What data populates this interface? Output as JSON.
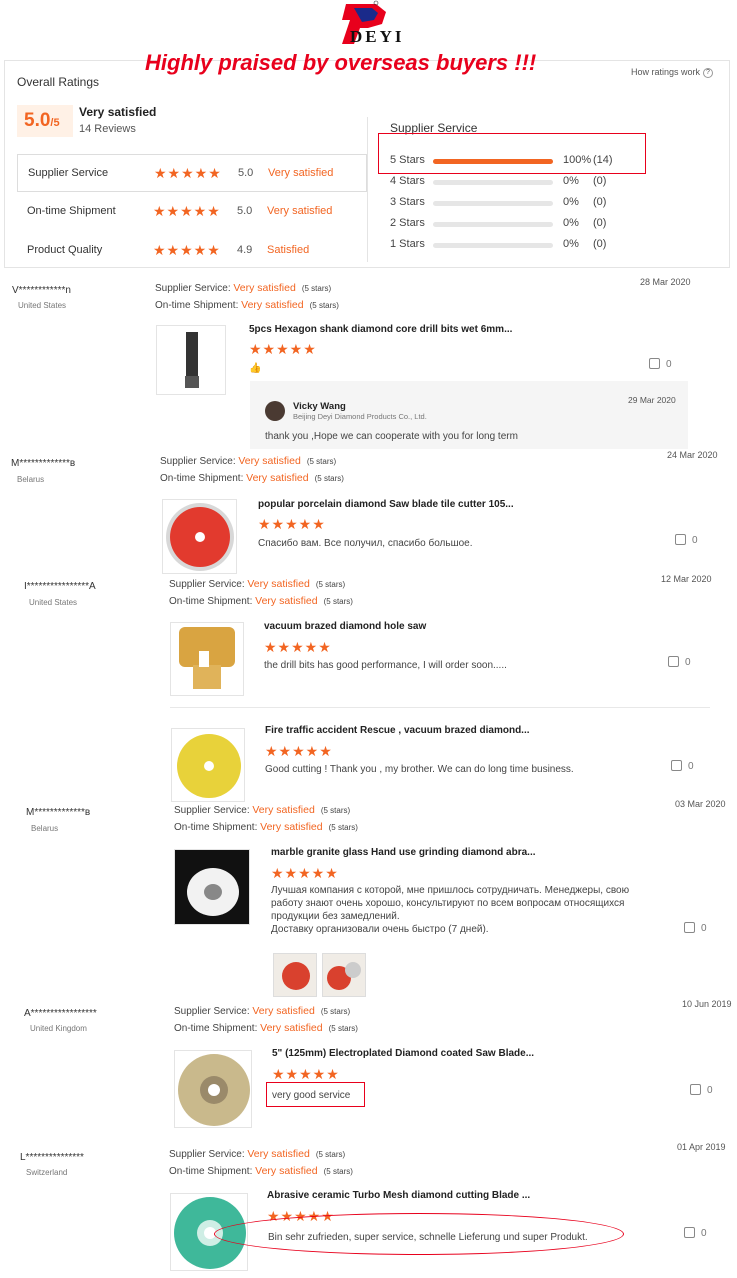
{
  "brand": {
    "logo_text": "DEYI",
    "headline": "Highly praised by overseas buyers !!!"
  },
  "overall": {
    "title": "Overall Ratings",
    "how_link": "How ratings work",
    "score": "5.0",
    "score_suffix": "/5",
    "label": "Very satisfied",
    "count": "14 Reviews",
    "categories": [
      {
        "label": "Supplier Service",
        "stars": "★★★★★",
        "score": "5.0",
        "word": "Very satisfied"
      },
      {
        "label": "On-time Shipment",
        "stars": "★★★★★",
        "score": "5.0",
        "word": "Very satisfied"
      },
      {
        "label": "Product Quality",
        "stars": "★★★★★",
        "score": "4.9",
        "word": "Satisfied"
      }
    ]
  },
  "supplier_service": {
    "title": "Supplier Service",
    "rows": [
      {
        "label": "5 Stars",
        "pct": "100%",
        "count": "(14)",
        "fraction": 1.0
      },
      {
        "label": "4 Stars",
        "pct": "0%",
        "count": "(0)",
        "fraction": 0
      },
      {
        "label": "3 Stars",
        "pct": "0%",
        "count": "(0)",
        "fraction": 0
      },
      {
        "label": "2 Stars",
        "pct": "0%",
        "count": "(0)",
        "fraction": 0
      },
      {
        "label": "1 Stars",
        "pct": "0%",
        "count": "(0)",
        "fraction": 0
      }
    ]
  },
  "labels": {
    "supplier_service": "Supplier Service:",
    "ontime_shipment": "On-time Shipment:",
    "very_satisfied": "Very satisfied",
    "five_stars": "(5 stars)",
    "stars": "★★★★★"
  },
  "reviews": [
    {
      "user": "V************n",
      "country": "United States",
      "date": "28 Mar 2020",
      "title": "5pcs Hexagon shank diamond core drill bits wet 6mm...",
      "text": "👍",
      "likes": "0"
    },
    {
      "user": "M*************в",
      "country": "Belarus",
      "date": "24 Mar 2020",
      "title": "popular porcelain diamond Saw blade tile cutter 105...",
      "text": "Спасибо вам. Все получил, спасибо большое.",
      "likes": "0"
    },
    {
      "user": "I****************A",
      "country": "United States",
      "date": "12 Mar 2020",
      "title": "vacuum brazed diamond hole saw",
      "text": "the drill bits has good performance, I will order soon.....",
      "likes": "0"
    },
    {
      "user": "",
      "country": "",
      "date": "",
      "title": "Fire traffic accident Rescue , vacuum brazed diamond...",
      "text": "Good cutting ! Thank you , my brother. We can do long time business.",
      "likes": "0"
    },
    {
      "user": "M*************в",
      "country": "Belarus",
      "date": "03 Mar 2020",
      "title": "marble granite glass Hand use grinding diamond abra...",
      "text_lines": [
        "Лучшая компания с которой, мне пришлось сотрудничать. Менеджеры, свою",
        "работу знают очень хорошо, консультируют по всем вопросам относящихся",
        "продукции без замедлений.",
        "Доставку организовали очень быстро (7 дней)."
      ],
      "likes": "0"
    },
    {
      "user": "A*****************",
      "country": "United Kingdom",
      "date": "10 Jun 2019",
      "title": "5\" (125mm) Electroplated Diamond coated Saw Blade...",
      "text": "very good service",
      "likes": "0"
    },
    {
      "user": "L***************",
      "country": "Switzerland",
      "date": "01 Apr 2019",
      "title": "Abrasive ceramic Turbo Mesh diamond cutting Blade ...",
      "text": "Bin sehr zufrieden, super service, schnelle Lieferung und super Produkt.",
      "likes": "0"
    }
  ],
  "reply": {
    "name": "Vicky Wang",
    "company": "Beijing Deyi Diamond Products Co., Ltd.",
    "date": "29 Mar 2020",
    "text": "thank you ,Hope we can cooperate with you for long term"
  },
  "colors": {
    "accent": "#f26522",
    "headline": "#e8001c",
    "annotation": "#e8001c"
  }
}
